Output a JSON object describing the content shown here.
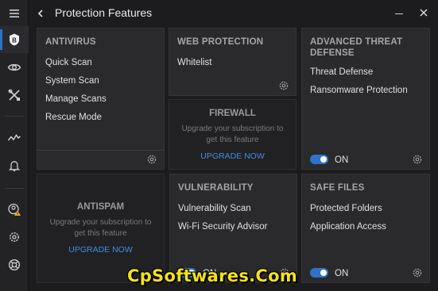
{
  "header": {
    "title": "Protection Features"
  },
  "sidebar": {
    "items": [
      {
        "icon": "menu-icon"
      },
      {
        "icon": "bitdefender-logo-icon",
        "active": true
      },
      {
        "icon": "eye-icon"
      },
      {
        "icon": "tools-icon"
      },
      {
        "icon": "activity-icon"
      },
      {
        "icon": "bell-icon"
      },
      {
        "icon": "account-warning-icon"
      },
      {
        "icon": "settings-icon"
      },
      {
        "icon": "support-icon"
      }
    ]
  },
  "cards": {
    "antivirus": {
      "title": "ANTIVIRUS",
      "items": [
        "Quick Scan",
        "System Scan",
        "Manage Scans",
        "Rescue Mode"
      ]
    },
    "web_protection": {
      "title": "WEB PROTECTION",
      "items": [
        "Whitelist"
      ]
    },
    "advanced_threat": {
      "title": "ADVANCED THREAT DEFENSE",
      "items": [
        "Threat Defense",
        "Ransomware Protection"
      ],
      "toggle": "ON"
    },
    "firewall": {
      "title": "FIREWALL",
      "message": "Upgrade your subscription to get this feature",
      "link": "UPGRADE NOW"
    },
    "antispam": {
      "title": "ANTISPAM",
      "message": "Upgrade your subscription to get this feature",
      "link": "UPGRADE NOW"
    },
    "vulnerability": {
      "title": "VULNERABILITY",
      "items": [
        "Vulnerability Scan",
        "Wi-Fi Security Advisor"
      ],
      "toggle": "ON"
    },
    "safe_files": {
      "title": "SAFE FILES",
      "items": [
        "Protected Folders",
        "Application Access"
      ],
      "toggle": "ON"
    }
  },
  "colors": {
    "accent": "#2f73c9",
    "link": "#3f8ee0",
    "watermark": "#f4e21a"
  },
  "watermark": "CpSoftwares.Com"
}
